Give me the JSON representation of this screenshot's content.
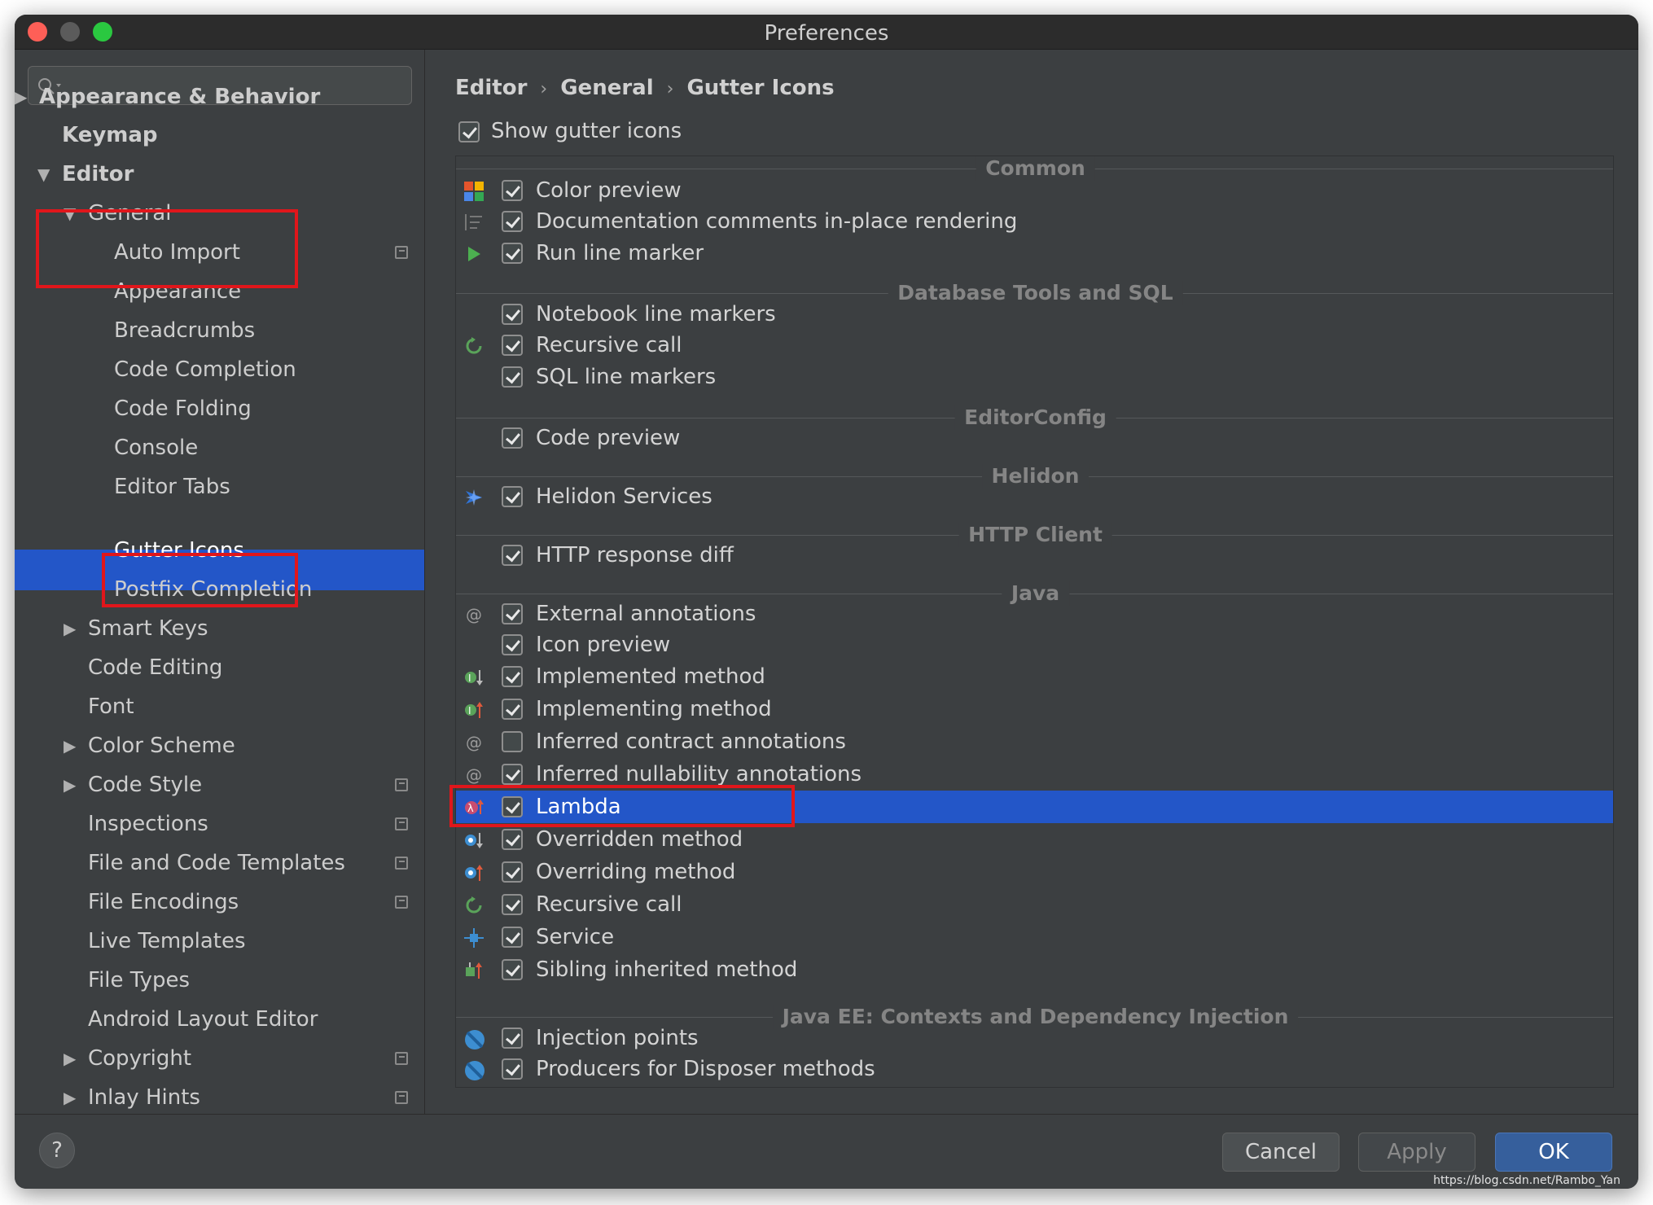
{
  "window": {
    "title": "Preferences"
  },
  "sidebar": {
    "search_placeholder": "",
    "items": [
      {
        "label": "Appearance & Behavior",
        "arrow": "▶"
      },
      {
        "label": "Keymap"
      },
      {
        "label": "Editor",
        "arrow": "▼"
      },
      {
        "label": "General",
        "arrow": "▼"
      },
      {
        "label": "Auto Import"
      },
      {
        "label": "Appearance"
      },
      {
        "label": "Breadcrumbs"
      },
      {
        "label": "Code Completion"
      },
      {
        "label": "Code Folding"
      },
      {
        "label": "Console"
      },
      {
        "label": "Editor Tabs"
      },
      {
        "label": "Gutter Icons"
      },
      {
        "label": "Postfix Completion"
      },
      {
        "label": "Smart Keys",
        "arrow": "▶"
      },
      {
        "label": "Code Editing"
      },
      {
        "label": "Font"
      },
      {
        "label": "Color Scheme",
        "arrow": "▶"
      },
      {
        "label": "Code Style",
        "arrow": "▶"
      },
      {
        "label": "Inspections"
      },
      {
        "label": "File and Code Templates"
      },
      {
        "label": "File Encodings"
      },
      {
        "label": "Live Templates"
      },
      {
        "label": "File Types"
      },
      {
        "label": "Android Layout Editor"
      },
      {
        "label": "Copyright",
        "arrow": "▶"
      },
      {
        "label": "Inlay Hints",
        "arrow": "▶"
      }
    ]
  },
  "breadcrumb": [
    "Editor",
    "General",
    "Gutter Icons"
  ],
  "breadcrumb_sep": "›",
  "show_gutter_icons": {
    "label": "Show gutter icons",
    "checked": true
  },
  "groups": [
    {
      "title": "Common",
      "rows": [
        {
          "label": "Color preview",
          "checked": true,
          "icon": "color-palette-icon"
        },
        {
          "label": "Documentation comments in-place rendering",
          "checked": true,
          "icon": "doc-lines-icon"
        },
        {
          "label": "Run line marker",
          "checked": true,
          "icon": "run-triangle-icon"
        }
      ]
    },
    {
      "title": "Database Tools and SQL",
      "rows": [
        {
          "label": "Notebook line markers",
          "checked": true,
          "icon": ""
        },
        {
          "label": "Recursive call",
          "checked": true,
          "icon": "recursive-call-icon"
        },
        {
          "label": "SQL line markers",
          "checked": true,
          "icon": ""
        }
      ]
    },
    {
      "title": "EditorConfig",
      "rows": [
        {
          "label": "Code preview",
          "checked": true,
          "icon": ""
        }
      ]
    },
    {
      "title": "Helidon",
      "rows": [
        {
          "label": "Helidon Services",
          "checked": true,
          "icon": "helidon-icon"
        }
      ]
    },
    {
      "title": "HTTP Client",
      "rows": [
        {
          "label": "HTTP response diff",
          "checked": true,
          "icon": ""
        }
      ]
    },
    {
      "title": "Java",
      "rows": [
        {
          "label": "External annotations",
          "checked": true,
          "icon": "at-sign-icon"
        },
        {
          "label": "Icon preview",
          "checked": true,
          "icon": ""
        },
        {
          "label": "Implemented method",
          "checked": true,
          "icon": "implemented-method-icon"
        },
        {
          "label": "Implementing method",
          "checked": true,
          "icon": "implementing-method-icon"
        },
        {
          "label": "Inferred contract annotations",
          "checked": false,
          "icon": "at-sign-icon"
        },
        {
          "label": "Inferred nullability annotations",
          "checked": true,
          "icon": "at-sign-icon"
        },
        {
          "label": "Lambda",
          "checked": true,
          "icon": "lambda-icon",
          "selected": true
        },
        {
          "label": "Overridden method",
          "checked": true,
          "icon": "overridden-method-icon"
        },
        {
          "label": "Overriding method",
          "checked": true,
          "icon": "overriding-method-icon"
        },
        {
          "label": "Recursive call",
          "checked": true,
          "icon": "recursive-call-icon"
        },
        {
          "label": "Service",
          "checked": true,
          "icon": "service-icon"
        },
        {
          "label": "Sibling inherited method",
          "checked": true,
          "icon": "sibling-method-icon"
        }
      ]
    },
    {
      "title": "Java EE: Contexts and Dependency Injection",
      "rows": [
        {
          "label": "Injection points",
          "checked": true,
          "icon": "cdi-icon"
        },
        {
          "label": "Producers for Disposer methods",
          "checked": true,
          "icon": "cdi-icon"
        }
      ]
    }
  ],
  "buttons": {
    "help": "?",
    "cancel": "Cancel",
    "apply": "Apply",
    "ok": "OK"
  },
  "watermark": "https://blog.csdn.net/Rambo_Yan",
  "colors": {
    "selection": "#2356c8",
    "highlight_box": "#e0161b"
  }
}
